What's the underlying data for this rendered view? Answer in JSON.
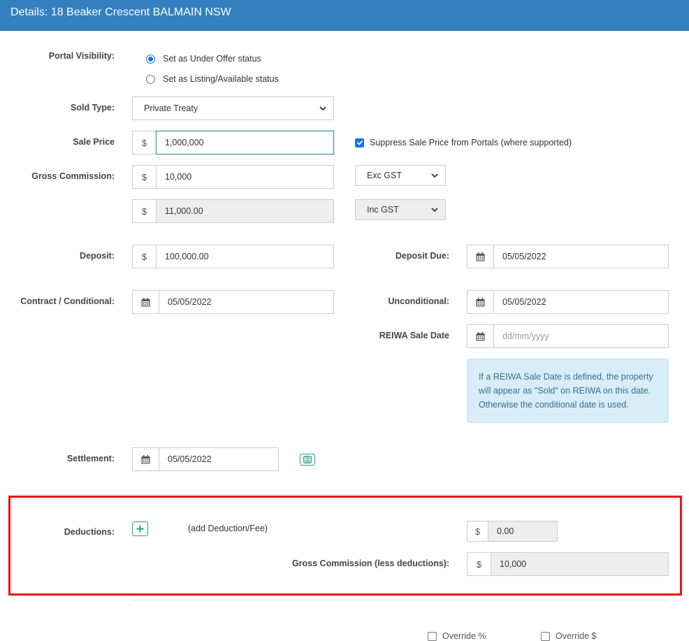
{
  "header": {
    "title": "Details: 18 Beaker Crescent BALMAIN NSW"
  },
  "portal_visibility": {
    "label": "Portal Visibility:",
    "options": [
      {
        "label": "Set as Under Offer status",
        "selected": true
      },
      {
        "label": "Set as Listing/Available status",
        "selected": false
      }
    ]
  },
  "sold_type": {
    "label": "Sold Type:",
    "value": "Private Treaty"
  },
  "sale_price": {
    "label": "Sale Price",
    "currency": "$",
    "value": "1,000,000",
    "suppress_label": "Suppress Sale Price from Portals (where supported)",
    "suppress_checked": true
  },
  "gross_commission": {
    "label": "Gross Commission:",
    "currency": "$",
    "exc_value": "10,000",
    "exc_type": "Exc GST",
    "inc_value": "11,000.00",
    "inc_type": "Inc GST"
  },
  "deposit": {
    "label": "Deposit:",
    "currency": "$",
    "value": "100,000.00"
  },
  "deposit_due": {
    "label": "Deposit Due:",
    "value": "05/05/2022"
  },
  "contract": {
    "label": "Contract / Conditional:",
    "value": "05/05/2022"
  },
  "unconditional": {
    "label": "Unconditional:",
    "value": "05/05/2022"
  },
  "reiwa": {
    "label": "REIWA Sale Date",
    "placeholder": "dd/mm/yyyy",
    "info": "If a REIWA Sale Date is defined, the property will appear as \"Sold\" on REIWA on this date. Otherwise the conditional date is used."
  },
  "settlement": {
    "label": "Settlement:",
    "value": "05/05/2022"
  },
  "deductions": {
    "label": "Deductions:",
    "add_label": "(add Deduction/Fee)",
    "currency": "$",
    "total": "0.00",
    "net_label": "Gross Commission (less deductions):",
    "net_value": "10,000"
  },
  "overrides": {
    "percent_label": "Override %",
    "dollar_label": "Override $"
  },
  "colors": {
    "header": "#3380c0",
    "accent": "#2a9d8f",
    "highlight": "#e8151b",
    "info_bg": "#d9edf7"
  },
  "icons": {
    "calendar": "calendar-icon",
    "calculator": "calculator-icon",
    "plus": "plus-icon",
    "chevron": "chevron-down-icon"
  }
}
